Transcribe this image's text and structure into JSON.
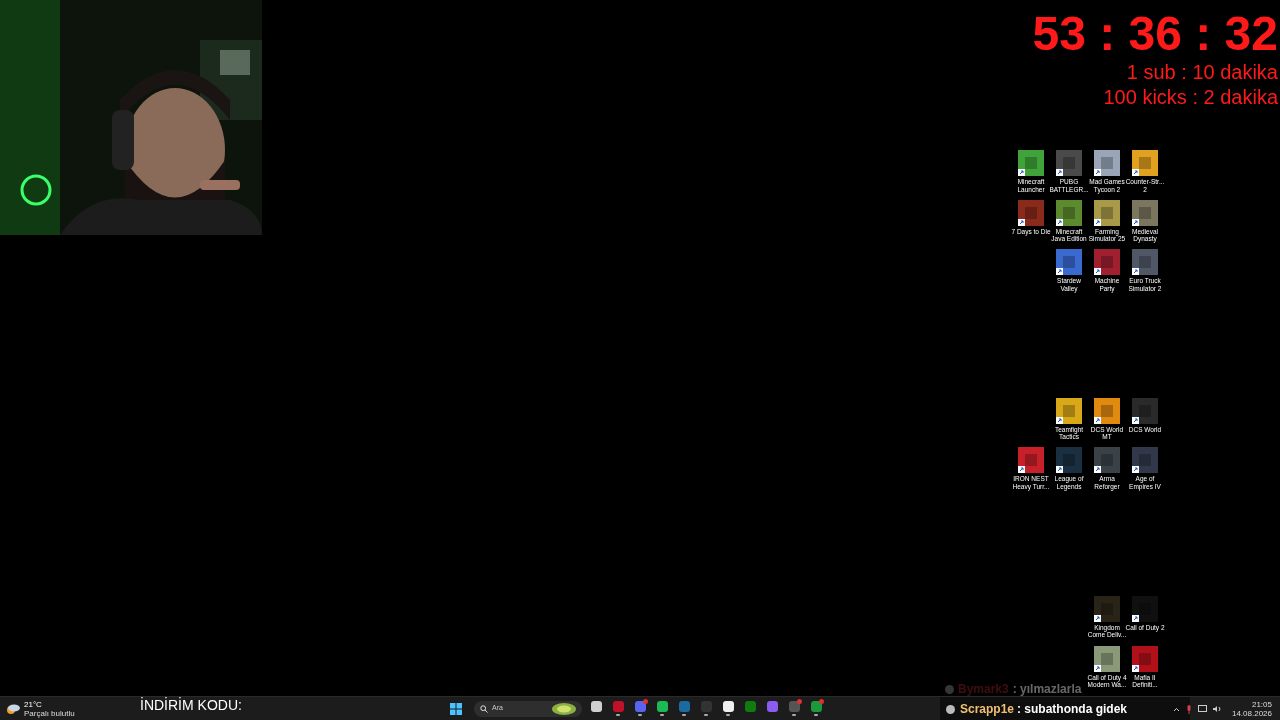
{
  "timer": {
    "time": "53 : 36 : 32",
    "rules": [
      "1 sub : 10 dakika",
      "100 kicks : 2 dakika"
    ]
  },
  "desktop_icon_groups": [
    {
      "rows": [
        [
          {
            "label": "Minecraft Launcher",
            "color": "#3fa33a"
          },
          {
            "label": "PUBG BATTLEGR...",
            "color": "#4a4a4a"
          },
          {
            "label": "Mad Games Tycoon 2",
            "color": "#9aa6b8"
          },
          {
            "label": "Counter-Str... 2",
            "color": "#e0a020"
          }
        ],
        [
          {
            "label": "7 Days to Die",
            "color": "#8a2a1a"
          },
          {
            "label": "Minecraft Java Edition",
            "color": "#5c8a2e"
          },
          {
            "label": "Farming Simulator 25",
            "color": "#a89a48"
          },
          {
            "label": "Medieval Dynasty",
            "color": "#7a7660"
          }
        ],
        [
          "",
          {
            "label": "Stardew Valley",
            "color": "#3a6ad0"
          },
          {
            "label": "Machine Party",
            "color": "#a02030"
          },
          {
            "label": "Euro Truck Simulator 2",
            "color": "#505868"
          }
        ]
      ]
    },
    {
      "rows": [
        [
          "",
          {
            "label": "Teamfight Tactics",
            "color": "#d8a818"
          },
          {
            "label": "DCS World MT",
            "color": "#e08a10"
          },
          {
            "label": "DCS World",
            "color": "#2a2a2a"
          }
        ],
        [
          {
            "label": "IRON NEST Heavy Turr...",
            "color": "#c8202a"
          },
          {
            "label": "League of Legends",
            "color": "#1a3040"
          },
          {
            "label": "Arma Reforger",
            "color": "#3a4248"
          },
          {
            "label": "Age of Empires IV",
            "color": "#30384a"
          }
        ]
      ]
    },
    {
      "rows": [
        [
          "",
          "",
          {
            "label": "Kingdom Come Deliv...",
            "color": "#2a2418"
          },
          {
            "label": "Call of Duty 2",
            "color": "#101010"
          }
        ],
        [
          "",
          "",
          {
            "label": "Call of Duty 4 Modern Wa...",
            "color": "#8a9a78"
          },
          {
            "label": "Mafia II Definiti...",
            "color": "#b0101a"
          }
        ]
      ]
    }
  ],
  "faded_chat": {
    "user": "Bymark3",
    "message": ": yılmazlarla"
  },
  "chat": {
    "user": "Scrapp1e",
    "message": ": subathonda gidek"
  },
  "taskbar": {
    "weather": {
      "temp": "21°C",
      "condition": "Parçalı bulutlu"
    },
    "promo": "İNDİRİM KODU:",
    "search": {
      "placeholder": "Ara"
    },
    "apps": [
      {
        "color": "#d0d0d0",
        "running": false,
        "badge": false
      },
      {
        "color": "#c0102a",
        "running": true,
        "badge": false
      },
      {
        "color": "#5865f2",
        "running": true,
        "badge": true
      },
      {
        "color": "#1db954",
        "running": true,
        "badge": false
      },
      {
        "color": "#1b6aa0",
        "running": true,
        "badge": false
      },
      {
        "color": "#333333",
        "running": true,
        "badge": false
      },
      {
        "color": "#f0f0f0",
        "running": true,
        "badge": false
      },
      {
        "color": "#107c10",
        "running": false,
        "badge": false
      },
      {
        "color": "#8a5cf0",
        "running": false,
        "badge": false
      },
      {
        "color": "#555555",
        "running": true,
        "badge": true
      },
      {
        "color": "#1a9a3a",
        "running": true,
        "badge": true
      }
    ],
    "clock": {
      "time": "21:05",
      "date": "14.08.2026"
    }
  }
}
